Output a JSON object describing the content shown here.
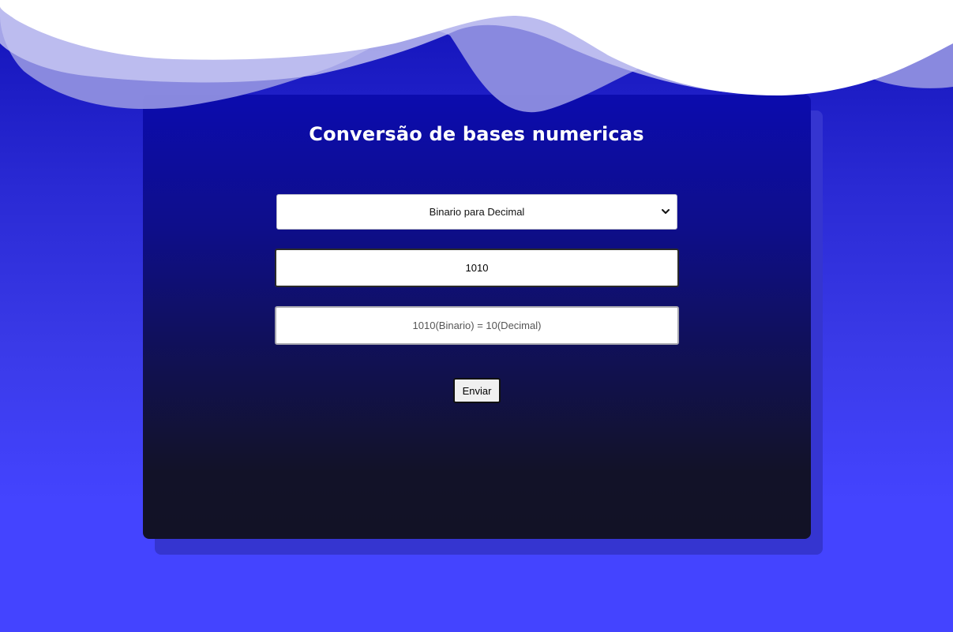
{
  "page": {
    "title": "Conversão de bases numericas"
  },
  "converter": {
    "mode_selected": "Binario para Decimal",
    "input_value": "1010",
    "result_text": "1010(Binario) = 10(Decimal)",
    "submit_label": "Enviar"
  },
  "colors": {
    "background_top": "#1212b8",
    "background_bottom": "#4444ff",
    "card_top": "#0c0cae",
    "card_bottom": "#121226",
    "wave_light": "#a8a8e4",
    "wave_white": "#ffffff"
  },
  "icons": {
    "select_arrow": "chevron-down-icon"
  }
}
